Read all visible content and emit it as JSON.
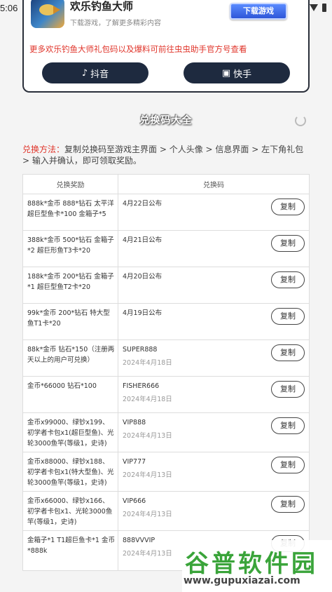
{
  "status_bar": {
    "time": "5:06"
  },
  "app_card": {
    "name": "欢乐钓鱼大师",
    "subtitle": "下载游戏，了解更多精彩内容",
    "download_label": "下载游戏",
    "promo_text": "更多欢乐钓鱼大师礼包码以及爆料可前往虫虫助手官方号查看",
    "douyin_label": "抖音",
    "kuaishou_label": "快手"
  },
  "section": {
    "title": "兑换码大全"
  },
  "instructions": {
    "label": "兑换方法：",
    "text": "复制兑换码至游戏主界面 > 个人头像 > 信息界面 > 左下角礼包 > 输入并确认，即可领取奖励。"
  },
  "table": {
    "headers": {
      "reward": "兑换奖励",
      "code": "兑换码"
    },
    "copy_label": "复制",
    "rows": [
      {
        "reward": "888k*金币  888*钻石 太平洋超巨型鱼卡*100 金箱子*5",
        "code": "4月22日公布",
        "date": ""
      },
      {
        "reward": "388k*金币  500*钻石 金箱子*2 超巨形鱼T3卡*20",
        "code": "4月21日公布",
        "date": ""
      },
      {
        "reward": "188k*金币  200*钻石 金箱子*1 超巨型鱼T2卡*20",
        "code": "4月20日公布",
        "date": ""
      },
      {
        "reward": "99k*金币  200*钻石 特大型鱼T1卡*20",
        "code": "4月19日公布",
        "date": ""
      },
      {
        "reward": "88k*金币  钻石*150（注册两天以上的用户可兑换）",
        "code": "SUPER888",
        "date": "2024年4月18日"
      },
      {
        "reward": "金币*66000 钻石*100",
        "code": "FISHER666",
        "date": "2024年4月18日"
      },
      {
        "reward": "金币x99000、绿钞x199、初学者卡包x1(超巨型鱼)、光轮3000鱼竿(等级1，史诗)",
        "code": "VIP888",
        "date": "2024年4月13日"
      },
      {
        "reward": "金币x88000、绿钞x188、初学者卡包x1(特大型鱼)、光轮3000鱼竿(等级1，史诗)",
        "code": "VIP777",
        "date": "2024年4月13日"
      },
      {
        "reward": "金币x66000、绿钞x166、初学者卡包x1、光轮3000鱼竿(等级1，史诗)",
        "code": "VIP666",
        "date": "2024年4月13日"
      },
      {
        "reward": "金箱子*1 T1超巨鱼卡*1 金币*888k",
        "code": "888VVVIP",
        "date": "2024年4月13日"
      }
    ]
  },
  "watermark": {
    "brand": "谷普软件园",
    "url": "www.gupuxiazai.com"
  }
}
